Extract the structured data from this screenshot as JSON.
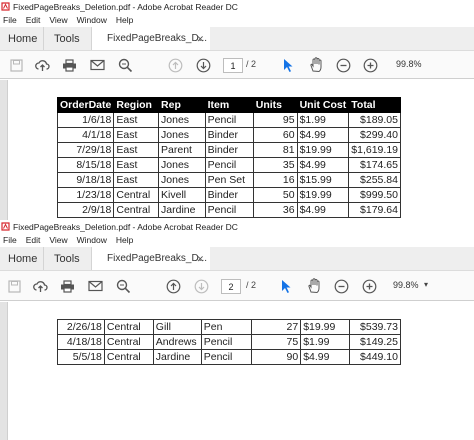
{
  "window_top": {
    "title": "FixedPageBreaks_Deletion.pdf - Adobe Acrobat Reader DC",
    "menu": [
      "File",
      "Edit",
      "View",
      "Window",
      "Help"
    ],
    "tabs": {
      "home": "Home",
      "tools": "Tools",
      "doc": "FixedPageBreaks_D..."
    },
    "page_current": "1",
    "page_total": "/ 2",
    "zoom": "99.8%"
  },
  "window_bottom": {
    "title": "FixedPageBreaks_Deletion.pdf - Adobe Acrobat Reader DC",
    "menu": [
      "File",
      "Edit",
      "View",
      "Window",
      "Help"
    ],
    "tabs": {
      "home": "Home",
      "tools": "Tools",
      "doc": "FixedPageBreaks_D..."
    },
    "page_current": "2",
    "page_total": "/ 2",
    "zoom": "99.8%"
  },
  "table_page1": {
    "headers": [
      "OrderDate",
      "Region",
      "Rep",
      "Item",
      "Units",
      "Unit Cost",
      "Total"
    ],
    "rows": [
      [
        "1/6/18",
        "East",
        "Jones",
        "Pencil",
        "95",
        "$1.99",
        "$189.05"
      ],
      [
        "4/1/18",
        "East",
        "Jones",
        "Binder",
        "60",
        "$4.99",
        "$299.40"
      ],
      [
        "7/29/18",
        "East",
        "Parent",
        "Binder",
        "81",
        "$19.99",
        "$1,619.19"
      ],
      [
        "8/15/18",
        "East",
        "Jones",
        "Pencil",
        "35",
        "$4.99",
        "$174.65"
      ],
      [
        "9/18/18",
        "East",
        "Jones",
        "Pen Set",
        "16",
        "$15.99",
        "$255.84"
      ],
      [
        "1/23/18",
        "Central",
        "Kivell",
        "Binder",
        "50",
        "$19.99",
        "$999.50"
      ],
      [
        "2/9/18",
        "Central",
        "Jardine",
        "Pencil",
        "36",
        "$4.99",
        "$179.64"
      ]
    ]
  },
  "table_page2": {
    "rows": [
      [
        "2/26/18",
        "Central",
        "Gill",
        "Pen",
        "27",
        "$19.99",
        "$539.73"
      ],
      [
        "4/18/18",
        "Central",
        "Andrews",
        "Pencil",
        "75",
        "$1.99",
        "$149.25"
      ],
      [
        "5/5/18",
        "Central",
        "Jardine",
        "Pencil",
        "90",
        "$4.99",
        "$449.10"
      ]
    ]
  },
  "colors": {
    "accent_blue": "#1473e6",
    "icon_gray": "#555555",
    "header_bg": "#000000"
  }
}
